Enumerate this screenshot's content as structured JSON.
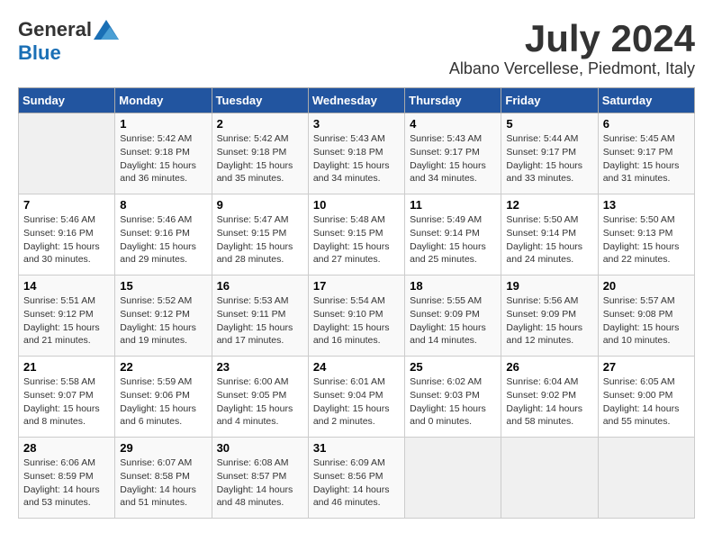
{
  "header": {
    "logo_general": "General",
    "logo_blue": "Blue",
    "month_year": "July 2024",
    "location": "Albano Vercellese, Piedmont, Italy"
  },
  "calendar": {
    "days_of_week": [
      "Sunday",
      "Monday",
      "Tuesday",
      "Wednesday",
      "Thursday",
      "Friday",
      "Saturday"
    ],
    "weeks": [
      [
        {
          "day": "",
          "info": ""
        },
        {
          "day": "1",
          "info": "Sunrise: 5:42 AM\nSunset: 9:18 PM\nDaylight: 15 hours\nand 36 minutes."
        },
        {
          "day": "2",
          "info": "Sunrise: 5:42 AM\nSunset: 9:18 PM\nDaylight: 15 hours\nand 35 minutes."
        },
        {
          "day": "3",
          "info": "Sunrise: 5:43 AM\nSunset: 9:18 PM\nDaylight: 15 hours\nand 34 minutes."
        },
        {
          "day": "4",
          "info": "Sunrise: 5:43 AM\nSunset: 9:17 PM\nDaylight: 15 hours\nand 34 minutes."
        },
        {
          "day": "5",
          "info": "Sunrise: 5:44 AM\nSunset: 9:17 PM\nDaylight: 15 hours\nand 33 minutes."
        },
        {
          "day": "6",
          "info": "Sunrise: 5:45 AM\nSunset: 9:17 PM\nDaylight: 15 hours\nand 31 minutes."
        }
      ],
      [
        {
          "day": "7",
          "info": "Sunrise: 5:46 AM\nSunset: 9:16 PM\nDaylight: 15 hours\nand 30 minutes."
        },
        {
          "day": "8",
          "info": "Sunrise: 5:46 AM\nSunset: 9:16 PM\nDaylight: 15 hours\nand 29 minutes."
        },
        {
          "day": "9",
          "info": "Sunrise: 5:47 AM\nSunset: 9:15 PM\nDaylight: 15 hours\nand 28 minutes."
        },
        {
          "day": "10",
          "info": "Sunrise: 5:48 AM\nSunset: 9:15 PM\nDaylight: 15 hours\nand 27 minutes."
        },
        {
          "day": "11",
          "info": "Sunrise: 5:49 AM\nSunset: 9:14 PM\nDaylight: 15 hours\nand 25 minutes."
        },
        {
          "day": "12",
          "info": "Sunrise: 5:50 AM\nSunset: 9:14 PM\nDaylight: 15 hours\nand 24 minutes."
        },
        {
          "day": "13",
          "info": "Sunrise: 5:50 AM\nSunset: 9:13 PM\nDaylight: 15 hours\nand 22 minutes."
        }
      ],
      [
        {
          "day": "14",
          "info": "Sunrise: 5:51 AM\nSunset: 9:12 PM\nDaylight: 15 hours\nand 21 minutes."
        },
        {
          "day": "15",
          "info": "Sunrise: 5:52 AM\nSunset: 9:12 PM\nDaylight: 15 hours\nand 19 minutes."
        },
        {
          "day": "16",
          "info": "Sunrise: 5:53 AM\nSunset: 9:11 PM\nDaylight: 15 hours\nand 17 minutes."
        },
        {
          "day": "17",
          "info": "Sunrise: 5:54 AM\nSunset: 9:10 PM\nDaylight: 15 hours\nand 16 minutes."
        },
        {
          "day": "18",
          "info": "Sunrise: 5:55 AM\nSunset: 9:09 PM\nDaylight: 15 hours\nand 14 minutes."
        },
        {
          "day": "19",
          "info": "Sunrise: 5:56 AM\nSunset: 9:09 PM\nDaylight: 15 hours\nand 12 minutes."
        },
        {
          "day": "20",
          "info": "Sunrise: 5:57 AM\nSunset: 9:08 PM\nDaylight: 15 hours\nand 10 minutes."
        }
      ],
      [
        {
          "day": "21",
          "info": "Sunrise: 5:58 AM\nSunset: 9:07 PM\nDaylight: 15 hours\nand 8 minutes."
        },
        {
          "day": "22",
          "info": "Sunrise: 5:59 AM\nSunset: 9:06 PM\nDaylight: 15 hours\nand 6 minutes."
        },
        {
          "day": "23",
          "info": "Sunrise: 6:00 AM\nSunset: 9:05 PM\nDaylight: 15 hours\nand 4 minutes."
        },
        {
          "day": "24",
          "info": "Sunrise: 6:01 AM\nSunset: 9:04 PM\nDaylight: 15 hours\nand 2 minutes."
        },
        {
          "day": "25",
          "info": "Sunrise: 6:02 AM\nSunset: 9:03 PM\nDaylight: 15 hours\nand 0 minutes."
        },
        {
          "day": "26",
          "info": "Sunrise: 6:04 AM\nSunset: 9:02 PM\nDaylight: 14 hours\nand 58 minutes."
        },
        {
          "day": "27",
          "info": "Sunrise: 6:05 AM\nSunset: 9:00 PM\nDaylight: 14 hours\nand 55 minutes."
        }
      ],
      [
        {
          "day": "28",
          "info": "Sunrise: 6:06 AM\nSunset: 8:59 PM\nDaylight: 14 hours\nand 53 minutes."
        },
        {
          "day": "29",
          "info": "Sunrise: 6:07 AM\nSunset: 8:58 PM\nDaylight: 14 hours\nand 51 minutes."
        },
        {
          "day": "30",
          "info": "Sunrise: 6:08 AM\nSunset: 8:57 PM\nDaylight: 14 hours\nand 48 minutes."
        },
        {
          "day": "31",
          "info": "Sunrise: 6:09 AM\nSunset: 8:56 PM\nDaylight: 14 hours\nand 46 minutes."
        },
        {
          "day": "",
          "info": ""
        },
        {
          "day": "",
          "info": ""
        },
        {
          "day": "",
          "info": ""
        }
      ]
    ]
  }
}
